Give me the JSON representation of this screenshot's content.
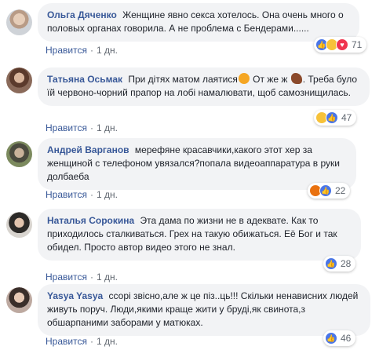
{
  "comments": [
    {
      "author": "Ольга Дяченко",
      "text": "Женщине явно секса хотелось. Она очень много о половых органах говорила. А не проблема с Бендерами......",
      "like_label": "Нравится",
      "time": "1 дн.",
      "reactions": [
        "like",
        "haha",
        "love"
      ],
      "reaction_count": "71"
    },
    {
      "author": "Татьяна Осьмак",
      "text_before": "При дітях матом лаятися",
      "text_middle": " От же ж ",
      "text_after": ". Треба було їй червоно-чорний прапор на лобі намалювати, щоб самознищилась.",
      "like_label": "Нравится",
      "time": "1 дн.",
      "reactions": [
        "haha",
        "like"
      ],
      "reaction_count": "47"
    },
    {
      "author": "Андрей Варганов",
      "text": "мерефяне красавчики,какого этот хер за женщиной с телефоном увязался?попала видеоаппаратура в руки долбаеба",
      "like_label": "Нравится",
      "time": "1 дн.",
      "reactions": [
        "angry",
        "like"
      ],
      "reaction_count": "22"
    },
    {
      "author": "Наталья Сорокина",
      "text": "Эта дама по жизни не в адеквате. Как то приходилось сталкиваться. Грех на такую обижаться. Её Бог и так обидел. Просто автор видео этого не знал.",
      "like_label": "Нравится",
      "time": "1 дн.",
      "reactions": [
        "like"
      ],
      "reaction_count": "28"
    },
    {
      "author": "Yasya Yasya",
      "text": "ссорі звісно,але ж це піз..ць!!! Скільки ненависних людей живуть поруч. Люди,якими краще жити у бруді,як свинота,з обшарпаними заборами у матюках.",
      "like_label": "Нравится",
      "time": "1 дн.",
      "reactions": [
        "like"
      ],
      "reaction_count": "46"
    }
  ],
  "colors": {
    "author": "#385898",
    "bubble": "#f2f3f5",
    "meta": "#606770",
    "like_reaction": "#4a76e8",
    "haha_reaction": "#f7c23a",
    "love_reaction": "#f0344f",
    "angry_reaction": "#e9710f"
  }
}
